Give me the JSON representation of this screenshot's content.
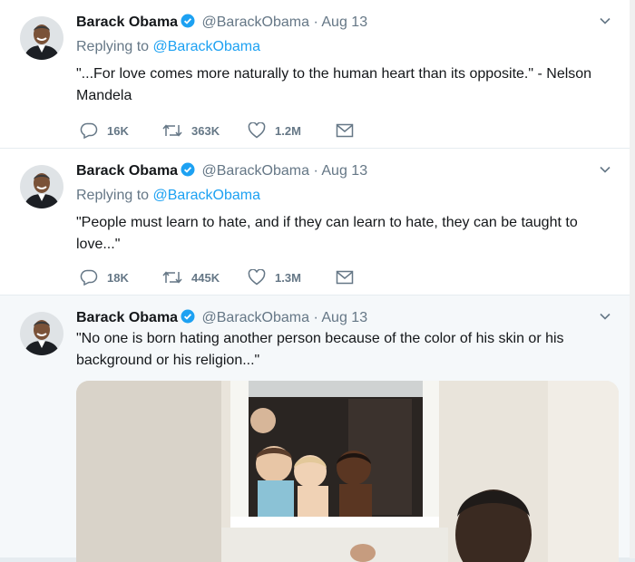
{
  "tweets": [
    {
      "name": "Barack Obama",
      "handle": "@BarackObama",
      "dot": "·",
      "date": "Aug 13",
      "replying_to_label": "Replying to",
      "replying_to_handle": "@BarackObama",
      "text": "\"...For love comes more naturally to the human heart than its opposite.\" - Nelson Mandela",
      "replies": "16K",
      "retweets": "363K",
      "likes": "1.2M"
    },
    {
      "name": "Barack Obama",
      "handle": "@BarackObama",
      "dot": "·",
      "date": "Aug 13",
      "replying_to_label": "Replying to",
      "replying_to_handle": "@BarackObama",
      "text": "\"People must learn to hate, and if they can learn to hate, they can be taught to love...\"",
      "replies": "18K",
      "retweets": "445K",
      "likes": "1.3M"
    },
    {
      "name": "Barack Obama",
      "handle": "@BarackObama",
      "dot": "·",
      "date": "Aug 13",
      "text": "\"No one is born hating another person because of the color of his skin or his background or his religion...\""
    }
  ],
  "colors": {
    "accent": "#1da1f2",
    "secondary_text": "#657786",
    "primary_text": "#14171a",
    "highlight_bg": "#f5f8fa"
  },
  "icons": {
    "verified": "verified-badge-icon",
    "caret": "chevron-down-icon",
    "reply": "reply-icon",
    "retweet": "retweet-icon",
    "like": "heart-icon",
    "dm": "envelope-icon"
  }
}
